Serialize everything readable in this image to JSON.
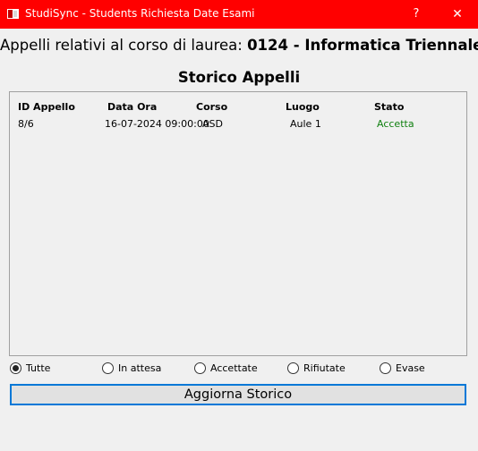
{
  "window": {
    "title": "StudiSync - Students Richiesta Date Esami",
    "help_glyph": "?",
    "close_glyph": "✕",
    "titlebar_color": "#ff0000"
  },
  "header": {
    "prefix": "Appelli relativi al corso di laurea: ",
    "course_code": "0124",
    "separator": " - ",
    "course_name": "Informatica Triennale"
  },
  "section_title": "Storico Appelli",
  "table": {
    "columns": [
      "ID Appello",
      "Data Ora",
      "Corso",
      "Luogo",
      "Stato"
    ],
    "rows": [
      {
        "id": "8/6",
        "datetime": "16-07-2024 09:00:00",
        "course": "ASD",
        "place": "Aule 1",
        "status": "Accetta"
      }
    ],
    "accepted_color": "#108010"
  },
  "filters": {
    "options": [
      "Tutte",
      "In attesa",
      "Accettate",
      "Rifiutate",
      "Evase"
    ],
    "selected": "Tutte"
  },
  "refresh_button": "Aggiorna Storico"
}
